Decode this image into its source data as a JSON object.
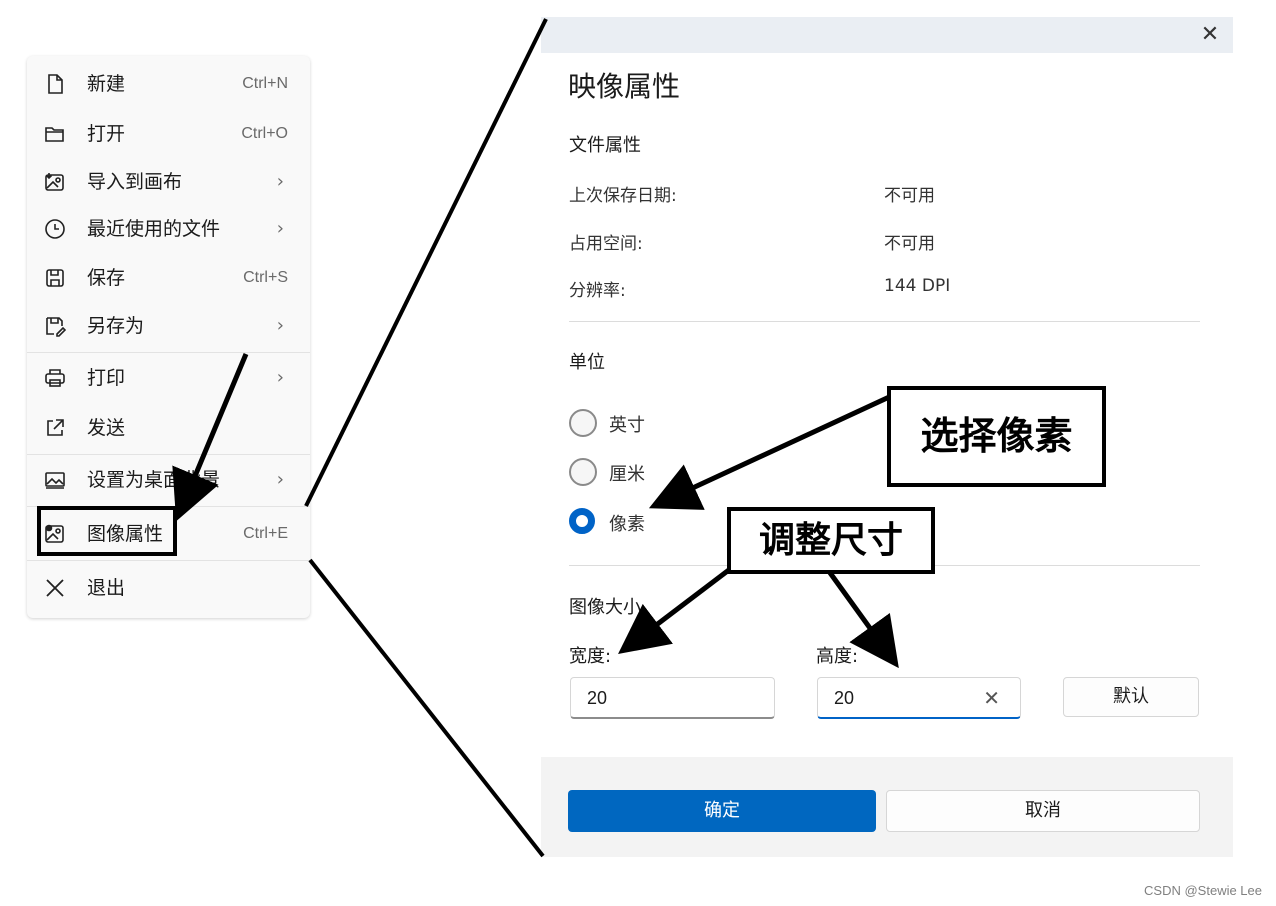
{
  "menu": {
    "items": [
      {
        "label": "新建",
        "shortcut": "Ctrl+N",
        "icon": "new-file-icon"
      },
      {
        "label": "打开",
        "shortcut": "Ctrl+O",
        "icon": "folder-open-icon"
      },
      {
        "label": "导入到画布",
        "submenu": "›",
        "icon": "import-image-icon"
      },
      {
        "label": "最近使用的文件",
        "submenu": "›",
        "icon": "clock-icon"
      },
      {
        "label": "保存",
        "shortcut": "Ctrl+S",
        "icon": "save-icon"
      },
      {
        "label": "另存为",
        "submenu": "›",
        "icon": "save-as-icon"
      },
      {
        "label": "打印",
        "submenu": "›",
        "icon": "printer-icon"
      },
      {
        "label": "发送",
        "icon": "share-icon"
      },
      {
        "label": "设置为桌面背景",
        "submenu": "›",
        "icon": "wallpaper-icon"
      },
      {
        "label": "图像属性",
        "shortcut": "Ctrl+E",
        "icon": "image-properties-icon"
      },
      {
        "label": "退出",
        "icon": "close-icon"
      }
    ]
  },
  "dialog": {
    "close_glyph": "✕",
    "title": "映像属性",
    "file_props": {
      "heading": "文件属性",
      "last_saved_label": "上次保存日期:",
      "last_saved_value": "不可用",
      "size_label": "占用空间:",
      "size_value": "不可用",
      "resolution_label": "分辨率:",
      "resolution_value": "144 DPI"
    },
    "units": {
      "heading": "单位",
      "options": [
        "英寸",
        "厘米",
        "像素"
      ],
      "selected": "像素"
    },
    "image_size": {
      "heading": "图像大小",
      "width_label": "宽度:",
      "width_value": "20",
      "height_label": "高度:",
      "height_value": "20",
      "clear_glyph": "✕",
      "default_button": "默认"
    },
    "ok_button": "确定",
    "cancel_button": "取消"
  },
  "annotations": {
    "select_pixels": "选择像素",
    "adjust_size": "调整尺寸"
  },
  "watermark": "CSDN @Stewie Lee",
  "colors": {
    "accent": "#0067c0",
    "annotation": "#000000"
  }
}
